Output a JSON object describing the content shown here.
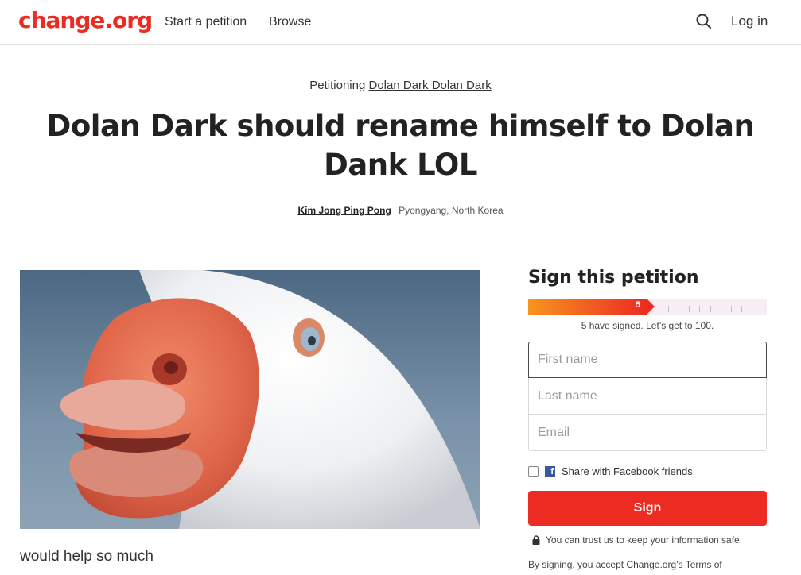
{
  "header": {
    "logo": "change.org",
    "nav": {
      "start": "Start a petition",
      "browse": "Browse"
    },
    "login": "Log in",
    "search_icon": "search-icon"
  },
  "petition": {
    "petitioning_prefix": "Petitioning",
    "target": "Dolan Dark Dolan Dark",
    "title": "Dolan Dark should rename himself to Dolan Dank LOL",
    "author": "Kim Jong Ping Pong",
    "location": "Pyongyang, North Korea",
    "description": "would help so much"
  },
  "sign": {
    "title": "Sign this petition",
    "count": "5",
    "goal": 100,
    "progress_fraction": 0.53,
    "signed_text": "5 have signed. Let’s get to 100.",
    "first_name_placeholder": "First name",
    "last_name_placeholder": "Last name",
    "email_placeholder": "Email",
    "share_label": "Share with Facebook friends",
    "button_label": "Sign",
    "trust_text": "You can trust us to keep your information safe.",
    "terms_prefix": "By signing, you accept Change.org’s",
    "terms_link": "Terms of"
  },
  "colors": {
    "brand": "#ec2c22",
    "progress_start": "#f7941d",
    "facebook": "#3b5998"
  }
}
